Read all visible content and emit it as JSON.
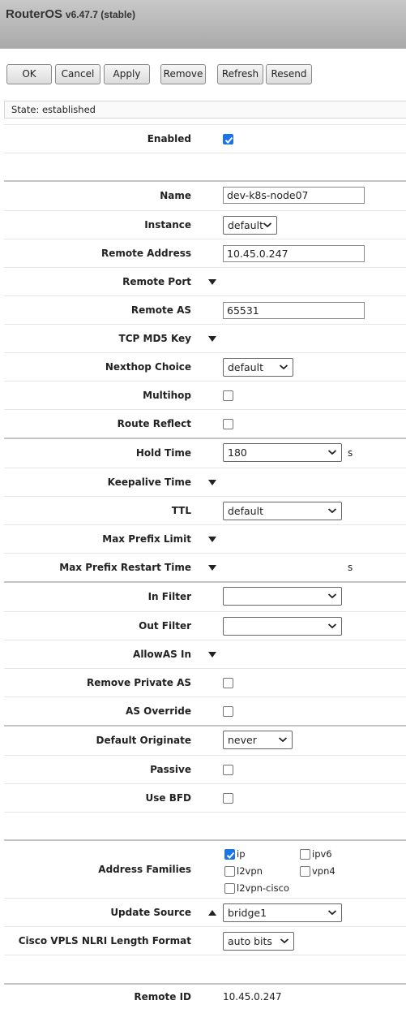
{
  "header": {
    "brand": "RouterOS",
    "version": "v6.47.7 (stable)"
  },
  "toolbar": {
    "ok": "OK",
    "cancel": "Cancel",
    "apply": "Apply",
    "remove": "Remove",
    "refresh": "Refresh",
    "resend": "Resend"
  },
  "status": {
    "text": "State: established"
  },
  "fields": {
    "enabled": {
      "label": "Enabled",
      "checked": true
    },
    "name": {
      "label": "Name",
      "value": "dev-k8s-node07"
    },
    "instance": {
      "label": "Instance",
      "value": "default"
    },
    "remote_address": {
      "label": "Remote Address",
      "value": "10.45.0.247"
    },
    "remote_port": {
      "label": "Remote Port"
    },
    "remote_as": {
      "label": "Remote AS",
      "value": "65531"
    },
    "tcp_md5_key": {
      "label": "TCP MD5 Key"
    },
    "nexthop_choice": {
      "label": "Nexthop Choice",
      "value": "default"
    },
    "multihop": {
      "label": "Multihop",
      "checked": false
    },
    "route_reflect": {
      "label": "Route Reflect",
      "checked": false
    },
    "hold_time": {
      "label": "Hold Time",
      "value": "180",
      "unit": "s"
    },
    "keepalive_time": {
      "label": "Keepalive Time"
    },
    "ttl": {
      "label": "TTL",
      "value": "default"
    },
    "max_prefix_limit": {
      "label": "Max Prefix Limit"
    },
    "max_prefix_restart_time": {
      "label": "Max Prefix Restart Time",
      "unit": "s"
    },
    "in_filter": {
      "label": "In Filter",
      "value": ""
    },
    "out_filter": {
      "label": "Out Filter",
      "value": ""
    },
    "allowas_in": {
      "label": "AllowAS In"
    },
    "remove_private_as": {
      "label": "Remove Private AS",
      "checked": false
    },
    "as_override": {
      "label": "AS Override",
      "checked": false
    },
    "default_originate": {
      "label": "Default Originate",
      "value": "never"
    },
    "passive": {
      "label": "Passive",
      "checked": false
    },
    "use_bfd": {
      "label": "Use BFD",
      "checked": false
    },
    "address_families": {
      "label": "Address Families",
      "options": [
        {
          "name": "ip",
          "checked": true
        },
        {
          "name": "ipv6",
          "checked": false
        },
        {
          "name": "l2vpn",
          "checked": false
        },
        {
          "name": "vpn4",
          "checked": false
        },
        {
          "name": "l2vpn-cisco",
          "checked": false
        }
      ]
    },
    "update_source": {
      "label": "Update Source",
      "value": "bridge1"
    },
    "cisco_vpls": {
      "label": "Cisco VPLS NLRI Length Format",
      "value": "auto bits"
    },
    "remote_id": {
      "label": "Remote ID",
      "value": "10.45.0.247"
    }
  },
  "colors": {
    "checkbox_accent": "#1a73e8",
    "header_top": "#c8c8c8",
    "header_bottom": "#a9a9a9"
  }
}
